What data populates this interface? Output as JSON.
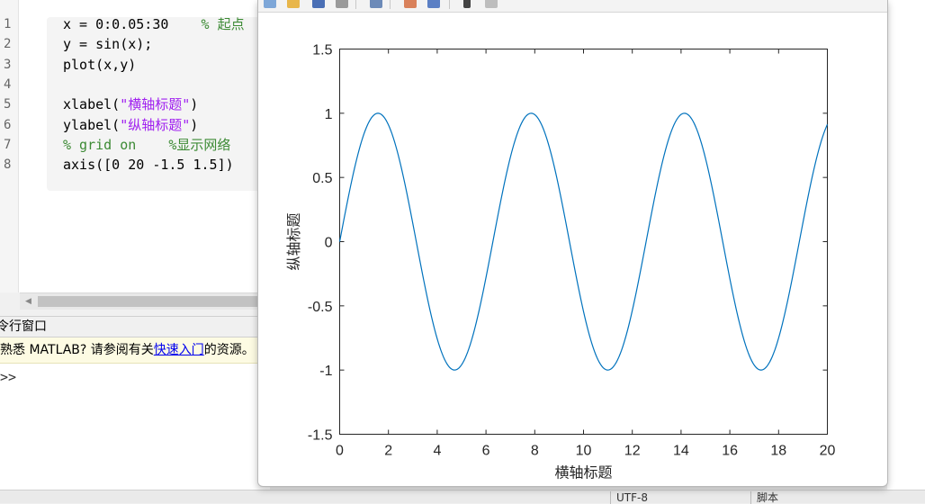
{
  "editor": {
    "line_numbers": [
      "1",
      "2",
      "3",
      "4",
      "5",
      "6",
      "7",
      "8"
    ],
    "lines": [
      {
        "segments": [
          {
            "t": "x = 0:0.05:30    ",
            "c": ""
          },
          {
            "t": "% 起点",
            "c": "comment"
          }
        ]
      },
      {
        "segments": [
          {
            "t": "y = sin(x);",
            "c": ""
          }
        ]
      },
      {
        "segments": [
          {
            "t": "plot(x,y)",
            "c": ""
          }
        ]
      },
      {
        "segments": []
      },
      {
        "segments": [
          {
            "t": "xlabel(",
            "c": ""
          },
          {
            "t": "\"横轴标题\"",
            "c": "str"
          },
          {
            "t": ")",
            "c": ""
          }
        ]
      },
      {
        "segments": [
          {
            "t": "ylabel(",
            "c": ""
          },
          {
            "t": "\"纵轴标题\"",
            "c": "str"
          },
          {
            "t": ")",
            "c": ""
          }
        ]
      },
      {
        "segments": [
          {
            "t": "% grid on    %显示网络",
            "c": "comment"
          }
        ]
      },
      {
        "segments": [
          {
            "t": "axis([0 20 -1.5 1.5])",
            "c": ""
          }
        ]
      }
    ]
  },
  "command_window": {
    "title": "令行窗口",
    "notice_prefix": "熟悉 MATLAB? 请参阅有关",
    "notice_link": "快速入门",
    "notice_suffix": "的资源。",
    "prompt": ">>"
  },
  "status_bar": {
    "encoding": "UTF-8",
    "type": "脚本"
  },
  "colors": {
    "line": "#0072bd",
    "comment": "#3c8a34",
    "string": "#a020f0"
  },
  "chart_data": {
    "type": "line",
    "title": "",
    "xlabel": "横轴标题",
    "ylabel": "纵轴标题",
    "xlim": [
      0,
      20
    ],
    "ylim": [
      -1.5,
      1.5
    ],
    "xticks": [
      0,
      2,
      4,
      6,
      8,
      10,
      12,
      14,
      16,
      18,
      20
    ],
    "yticks": [
      -1.5,
      -1,
      -0.5,
      0,
      0.5,
      1,
      1.5
    ],
    "ytick_labels": [
      "-1.5",
      "-1",
      "-0.5",
      "0",
      "0.5",
      "1",
      "1.5"
    ],
    "grid": false,
    "series": [
      {
        "x_start": 0,
        "x_end": 30,
        "x_step": 0.05,
        "x": [
          0,
          1.5708,
          4.7124,
          7.854,
          10.9956,
          14.1372,
          17.2788,
          20
        ],
        "y": [
          0,
          1,
          -1,
          1,
          -1,
          1,
          -1,
          0.913
        ]
      }
    ]
  }
}
